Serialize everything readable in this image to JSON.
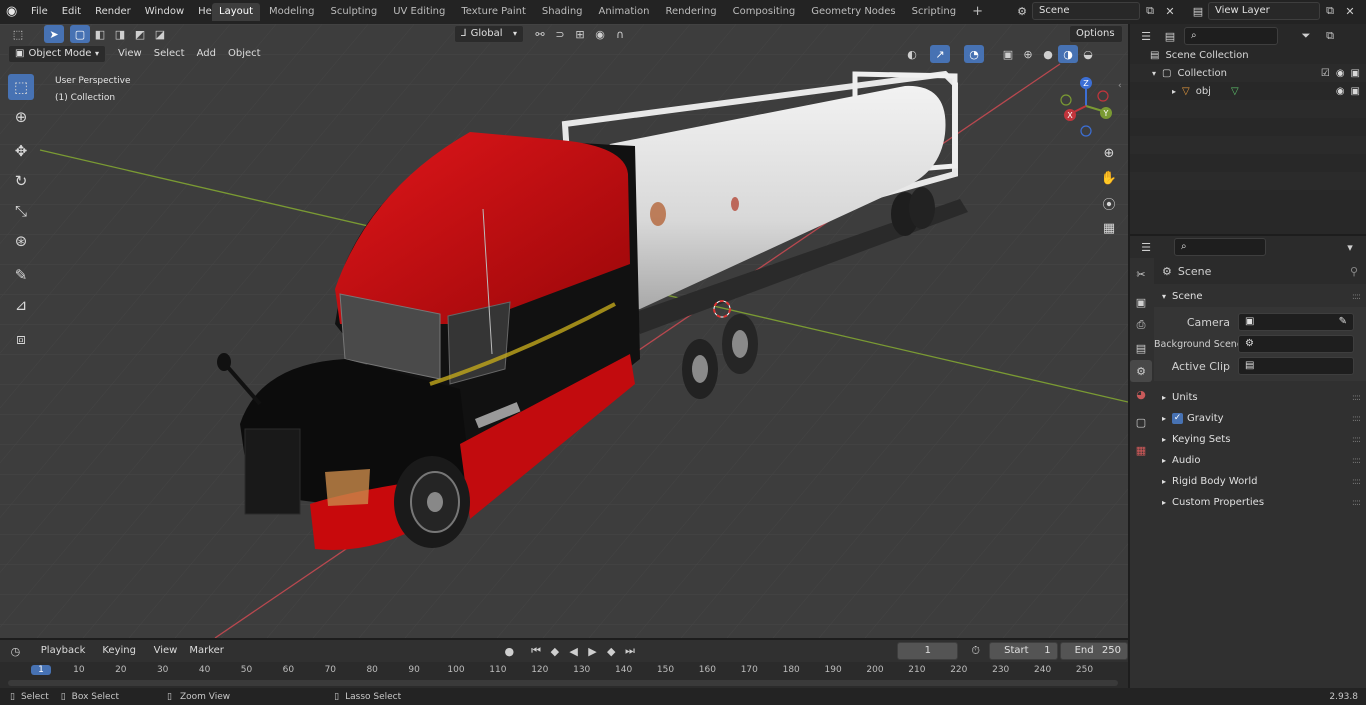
{
  "topbar": {
    "menus": [
      "File",
      "Edit",
      "Render",
      "Window",
      "Help"
    ],
    "workspaces": [
      "Layout",
      "Modeling",
      "Sculpting",
      "UV Editing",
      "Texture Paint",
      "Shading",
      "Animation",
      "Rendering",
      "Compositing",
      "Geometry Nodes",
      "Scripting"
    ],
    "active_workspace": "Layout",
    "scene_name": "Scene",
    "view_layer": "View Layer"
  },
  "viewport": {
    "header": {
      "mode": "Object Mode",
      "menus": [
        "View",
        "Select",
        "Add",
        "Object"
      ],
      "orientation": "Global",
      "options": "Options"
    },
    "overlay": {
      "perspective": "User Perspective",
      "collection": "(1) Collection"
    },
    "gizmo": {
      "z": "Z",
      "y": "Y",
      "x": "X"
    }
  },
  "outliner": {
    "scene_collection": "Scene Collection",
    "collection": "Collection",
    "object": "obj"
  },
  "properties": {
    "context": "Scene",
    "panel": "Scene",
    "fields": [
      {
        "label": "Camera"
      },
      {
        "label": "Background Scene"
      },
      {
        "label": "Active Clip"
      }
    ],
    "subpanels": [
      "Units",
      "Gravity",
      "Keying Sets",
      "Audio",
      "Rigid Body World",
      "Custom Properties"
    ]
  },
  "timeline": {
    "menus": [
      "Playback",
      "Keying",
      "View",
      "Marker"
    ],
    "current_frame": "1",
    "start_label": "Start",
    "start": "1",
    "end_label": "End",
    "end": "250",
    "ruler": [
      "1",
      "10",
      "20",
      "30",
      "40",
      "50",
      "60",
      "70",
      "80",
      "90",
      "100",
      "110",
      "120",
      "130",
      "140",
      "150",
      "160",
      "170",
      "180",
      "190",
      "200",
      "210",
      "220",
      "230",
      "240",
      "250"
    ]
  },
  "statusbar": {
    "select": "Select",
    "box_select": "Box Select",
    "zoom_view": "Zoom View",
    "lasso_select": "Lasso Select",
    "version": "2.93.8"
  },
  "colors": {
    "accent": "#4772b3",
    "x_axis": "#b8484f",
    "y_axis": "#7a9a33",
    "truck_red": "#c8090c"
  }
}
